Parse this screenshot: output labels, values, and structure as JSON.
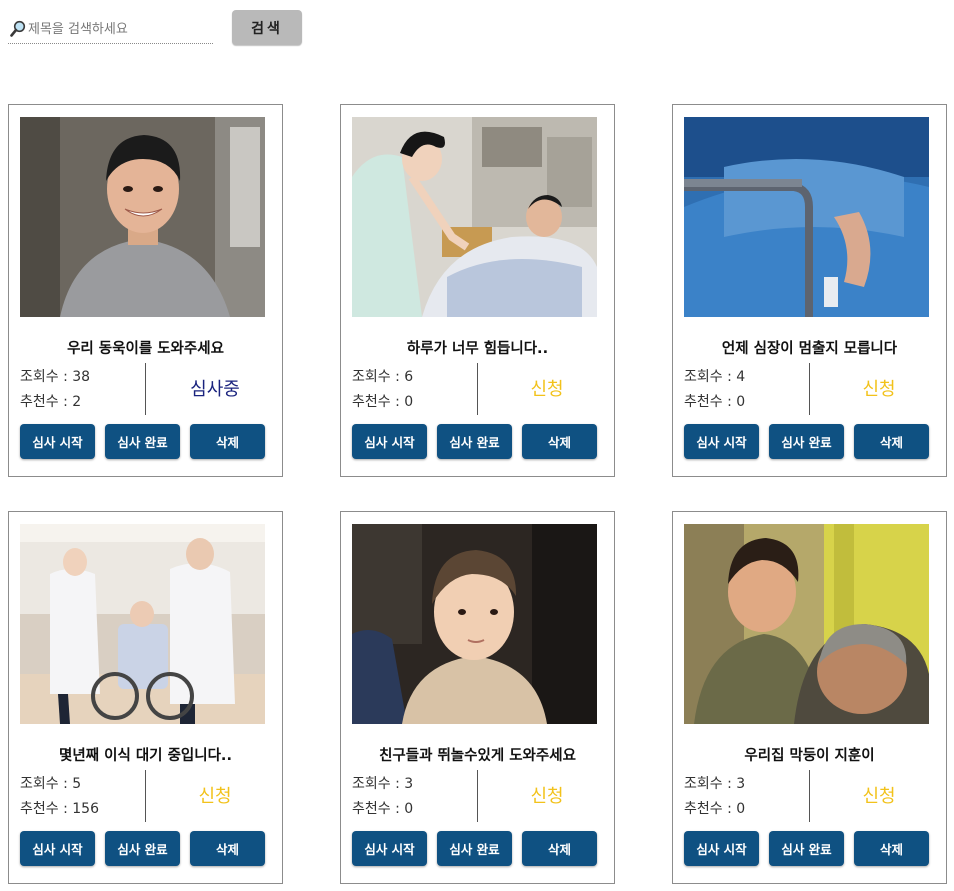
{
  "search": {
    "placeholder": "제목을 검색하세요",
    "value": "",
    "button_label": "검색",
    "icon": "magnifier-icon"
  },
  "cards": [
    {
      "title": "우리 동욱이를 도와주세요",
      "views_label": "조회수 : 38",
      "likes_label": "추천수 : 2",
      "status": "심사중",
      "status_color": "#1a237e",
      "photo": "smiling-boy-photo"
    },
    {
      "title": "하루가 너무 힘듭니다..",
      "views_label": "조회수 : 6",
      "likes_label": "추천수 : 0",
      "status": "신청",
      "status_color": "#f2c21b",
      "photo": "nurse-patient-photo"
    },
    {
      "title": "언제 심장이 멈출지 모릅니다",
      "views_label": "조회수 : 4",
      "likes_label": "추천수 : 0",
      "status": "신청",
      "status_color": "#f2c21b",
      "photo": "hospital-bed-photo"
    },
    {
      "title": "몇년째 이식 대기 중입니다..",
      "views_label": "조회수 : 5",
      "likes_label": "추천수 : 156",
      "status": "신청",
      "status_color": "#f2c21b",
      "photo": "doctors-wheelchair-photo"
    },
    {
      "title": "친구들과 뛰놀수있게 도와주세요",
      "views_label": "조회수 : 3",
      "likes_label": "추천수 : 0",
      "status": "신청",
      "status_color": "#f2c21b",
      "photo": "toddler-boy-photo"
    },
    {
      "title": "우리집 막둥이 지훈이",
      "views_label": "조회수 : 3",
      "likes_label": "추천수 : 0",
      "status": "신청",
      "status_color": "#f2c21b",
      "photo": "boy-grandfather-photo"
    }
  ],
  "actions": {
    "start_review": "심사 시작",
    "complete_review": "심사 완료",
    "delete": "삭제"
  },
  "colors": {
    "button": "#0f5182",
    "search_button": "#b9b9b9",
    "reviewing": "#1a237e",
    "applied": "#f2c21b"
  }
}
